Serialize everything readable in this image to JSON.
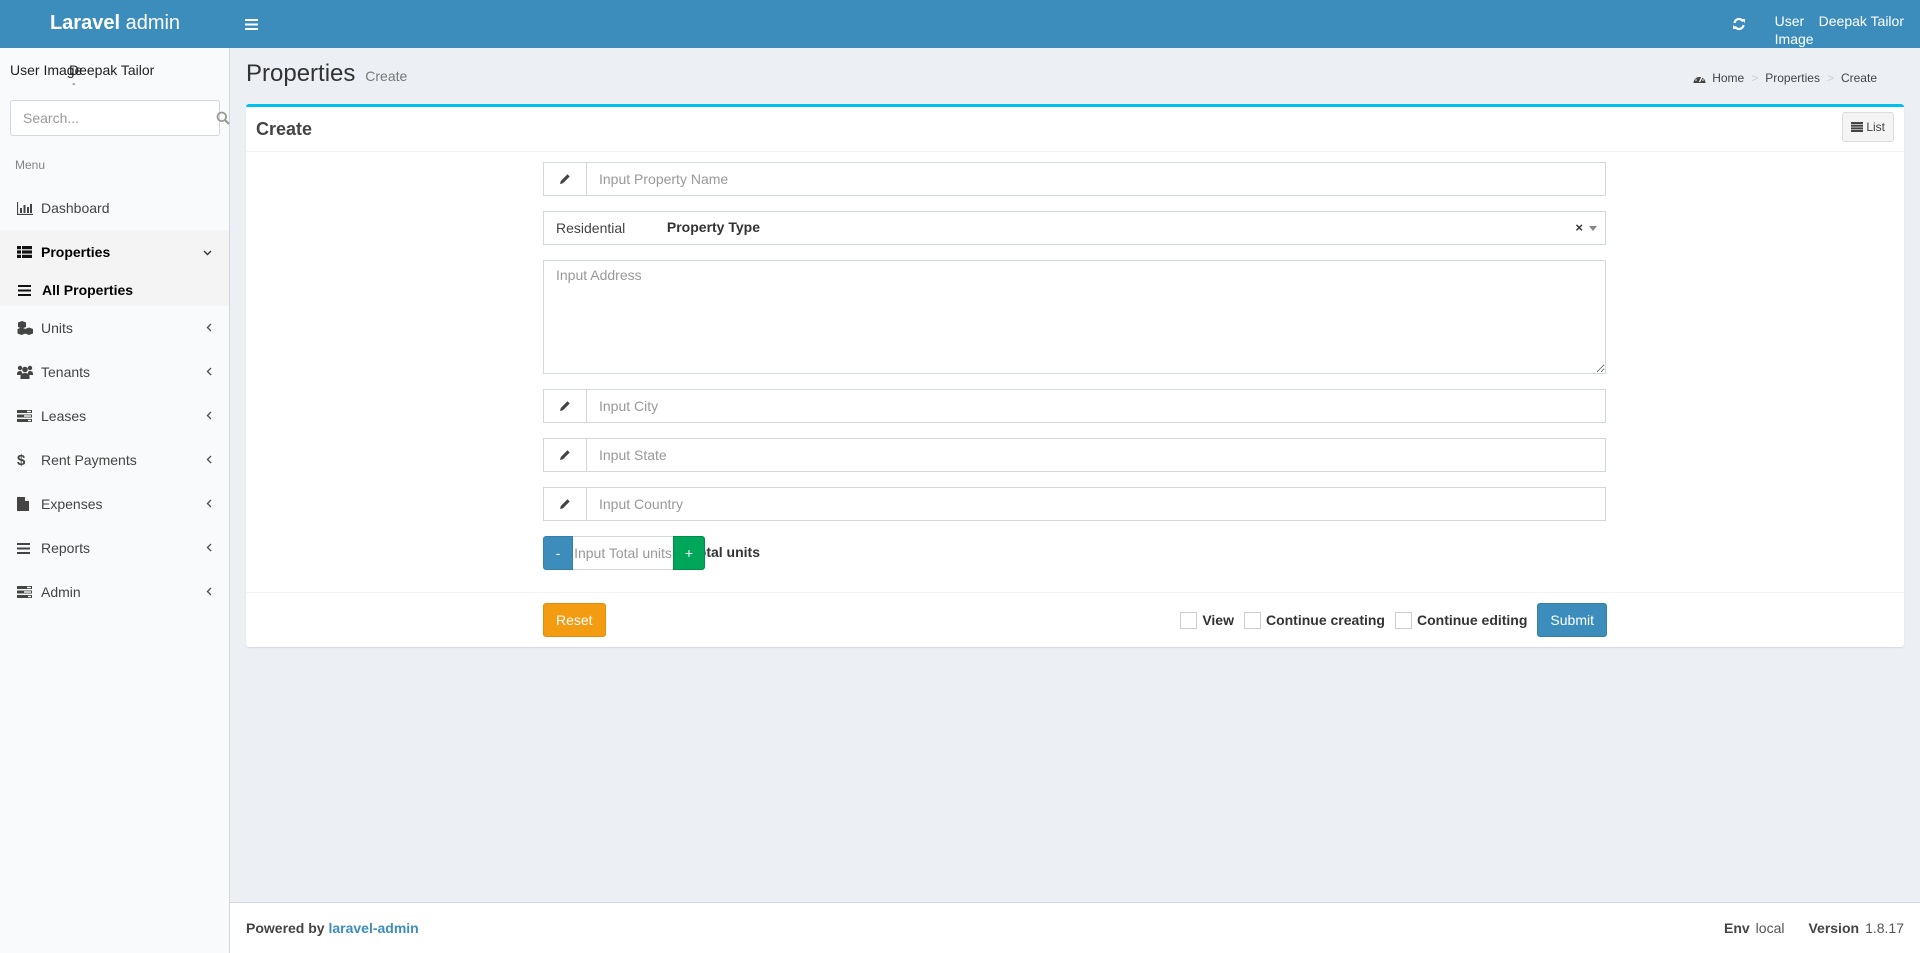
{
  "header": {
    "logo_bold": "Laravel",
    "logo_rest": " admin",
    "user_image_alt": "User Image",
    "user_name": "Deepak Tailor"
  },
  "sidebar": {
    "user_image_alt": "User Image",
    "user_name": "Deepak Tailor",
    "user_status": "-",
    "search_placeholder": "Search...",
    "menu_header": "Menu",
    "items": [
      {
        "label": "Dashboard",
        "icon": "bar-chart-icon"
      },
      {
        "label": "Properties",
        "icon": "th-list-icon",
        "expanded": true,
        "children": [
          {
            "label": "All Properties",
            "icon": "bars-icon"
          }
        ]
      },
      {
        "label": "Units",
        "icon": "cubes-icon"
      },
      {
        "label": "Tenants",
        "icon": "users-icon"
      },
      {
        "label": "Leases",
        "icon": "tasks-icon"
      },
      {
        "label": "Rent Payments",
        "icon": "dollar-icon"
      },
      {
        "label": "Expenses",
        "icon": "file-icon"
      },
      {
        "label": "Reports",
        "icon": "bars-icon"
      },
      {
        "label": "Admin",
        "icon": "tasks-icon"
      }
    ]
  },
  "content": {
    "title": "Properties",
    "subtitle": "Create",
    "breadcrumb": [
      "Home",
      "Properties",
      "Create"
    ]
  },
  "form": {
    "box_title": "Create",
    "list_button": "List",
    "fields": {
      "property_name": {
        "label": "Property Name",
        "placeholder": "Input Property Name",
        "value": ""
      },
      "property_type": {
        "label": "Property Type",
        "value": "Residential"
      },
      "address": {
        "label": "Address",
        "placeholder": "Input Address",
        "value": ""
      },
      "city": {
        "label": "City",
        "placeholder": "Input City",
        "value": ""
      },
      "state": {
        "label": "State",
        "placeholder": "Input State",
        "value": ""
      },
      "country": {
        "label": "Country",
        "placeholder": "Input Country",
        "value": ""
      },
      "total_units": {
        "label": "Total units",
        "placeholder": "Input Total units",
        "value": "",
        "minus": "-",
        "plus": "+"
      }
    },
    "reset_label": "Reset",
    "checkboxes": [
      {
        "label": "View",
        "checked": false
      },
      {
        "label": "Continue creating",
        "checked": false
      },
      {
        "label": "Continue editing",
        "checked": false
      }
    ],
    "submit_label": "Submit"
  },
  "footer": {
    "powered_by": "Powered by ",
    "powered_link": "laravel-admin",
    "env_label": "Env",
    "env_value": "local",
    "version_label": "Version",
    "version_value": "1.8.17"
  },
  "colors": {
    "primary": "#3c8dbc",
    "success": "#00a65a",
    "warning": "#f39c12",
    "box_accent": "#00c0ef"
  }
}
